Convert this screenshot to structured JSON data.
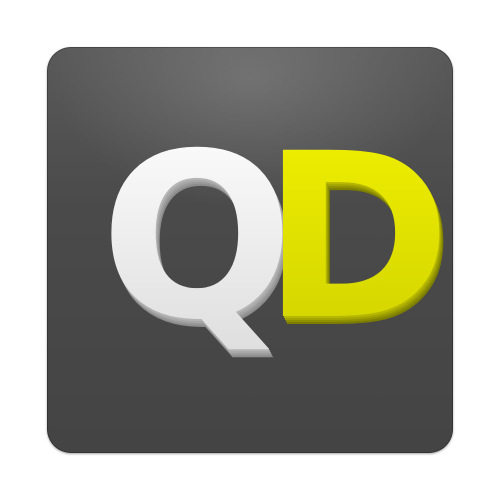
{
  "icon": {
    "letters": [
      "Q",
      "D"
    ],
    "tile_color": "#4d4d4d",
    "letter_colors": {
      "Q": "#e6e6e6",
      "D": "#dfe000"
    }
  }
}
